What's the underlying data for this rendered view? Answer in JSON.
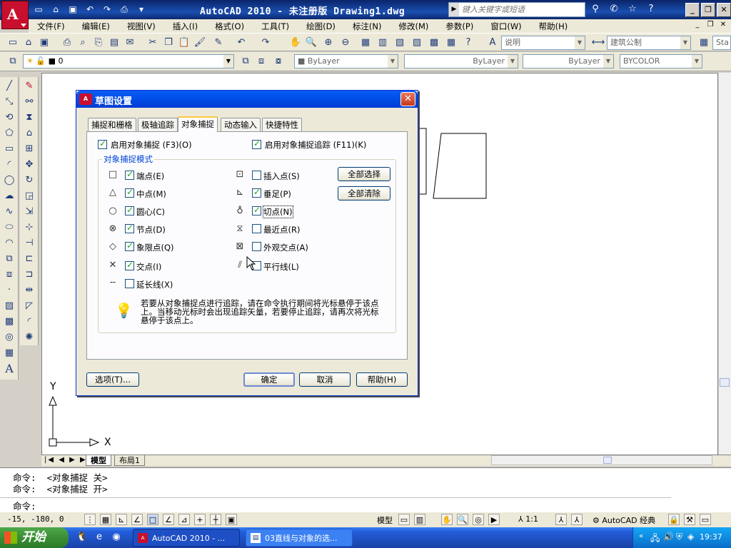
{
  "app": {
    "window_title": "AutoCAD 2010 - 未注册版  Drawing1.dwg",
    "search_placeholder": "键入关键字或短语"
  },
  "menu": [
    "文件(F)",
    "编辑(E)",
    "视图(V)",
    "插入(I)",
    "格式(O)",
    "工具(T)",
    "绘图(D)",
    "标注(N)",
    "修改(M)",
    "参数(P)",
    "窗口(W)",
    "帮助(H)"
  ],
  "toolbar": {
    "text_style": "说明",
    "dim_style": "建筑公制",
    "overflow_label": "Sta"
  },
  "layer_toolbar": {
    "layer_name": "0",
    "color": "ByLayer",
    "linetype": "ByLayer",
    "lineweight": "ByLayer",
    "plotstyle": "BYCOLOR"
  },
  "dialog": {
    "title": "草图设置",
    "tabs": [
      "捕捉和栅格",
      "极轴追踪",
      "对象捕捉",
      "动态输入",
      "快捷特性"
    ],
    "active_tab": 2,
    "enable_osnap": "启用对象捕捉 (F3)(O)",
    "enable_tracking": "启用对象捕捉追踪 (F11)(K)",
    "group_title": "对象捕捉模式",
    "left_modes": [
      {
        "symbol": "□",
        "label": "端点(E)",
        "checked": true
      },
      {
        "symbol": "△",
        "label": "中点(M)",
        "checked": true
      },
      {
        "symbol": "○",
        "label": "圆心(C)",
        "checked": true
      },
      {
        "symbol": "⊗",
        "label": "节点(D)",
        "checked": true
      },
      {
        "symbol": "◇",
        "label": "象限点(Q)",
        "checked": true
      },
      {
        "symbol": "✕",
        "label": "交点(I)",
        "checked": true
      },
      {
        "symbol": "╌",
        "label": "延长线(X)",
        "checked": false
      }
    ],
    "right_modes": [
      {
        "symbol": "⊡",
        "label": "插入点(S)",
        "checked": false
      },
      {
        "symbol": "⊾",
        "label": "垂足(P)",
        "checked": true
      },
      {
        "symbol": "♁",
        "label": "切点(N)",
        "checked": true
      },
      {
        "symbol": "⧖",
        "label": "最近点(R)",
        "checked": false
      },
      {
        "symbol": "⊠",
        "label": "外观交点(A)",
        "checked": false
      },
      {
        "symbol": "⫽",
        "label": "平行线(L)",
        "checked": false
      }
    ],
    "select_all": "全部选择",
    "clear_all": "全部清除",
    "tip": "若要从对象捕捉点进行追踪，请在命令执行期间将光标悬停于该点上。当移动光标时会出现追踪矢量，若要停止追踪，请再次将光标悬停于该点上。",
    "options_btn": "选项(T)...",
    "ok_btn": "确定",
    "cancel_btn": "取消",
    "help_btn": "帮助(H)"
  },
  "layout_tabs": [
    "模型",
    "布局1"
  ],
  "command": {
    "lines": [
      "命令:  <对象捕捉 关>",
      "命令:  <对象捕捉 开>"
    ],
    "prompt": "命令:"
  },
  "status": {
    "coords": "-15, -180, 0",
    "model_label": "模型",
    "scale": "1:1",
    "workspace": "AutoCAD 经典"
  },
  "axis": {
    "x": "X",
    "y": "Y"
  },
  "taskbar": {
    "start": "开始",
    "tasks": [
      "AutoCAD 2010 - ...",
      "03直线与对象的选..."
    ],
    "clock": "19:37"
  }
}
